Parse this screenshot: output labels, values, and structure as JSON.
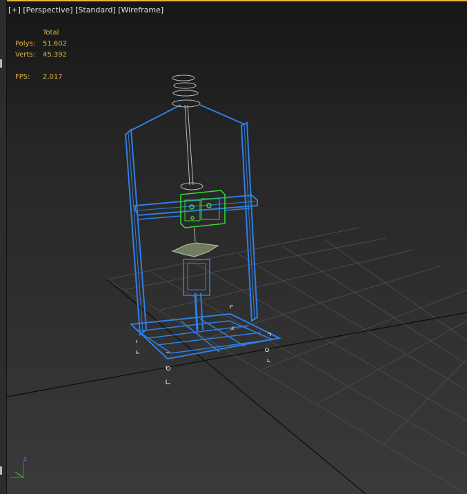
{
  "viewport": {
    "labels": [
      "[+]",
      "[Perspective]",
      "[Standard]",
      "[Wireframe]"
    ]
  },
  "stats": {
    "header": "Total",
    "polys_label": "Polys:",
    "polys_value": "51.602",
    "verts_label": "Verts:",
    "verts_value": "45.392",
    "fps_label": "FPS:",
    "fps_value": "2,017"
  },
  "gizmo": {
    "z_label": "z"
  },
  "colors": {
    "frame": "#2f7fe6",
    "selected": "#33dd33",
    "grid": "#4b4b4b",
    "stats_text": "#e1b54a",
    "active_border": "#e9b640"
  }
}
